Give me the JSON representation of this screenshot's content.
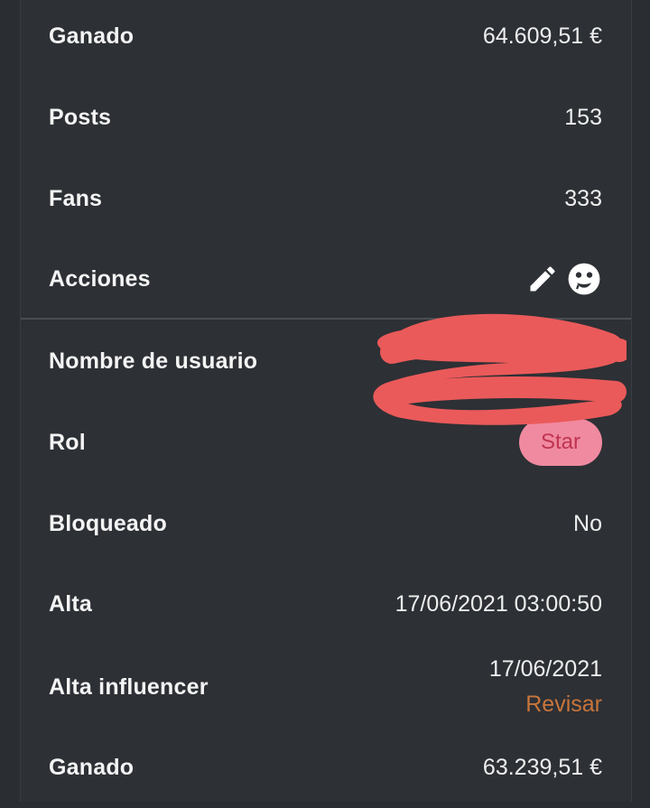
{
  "rows": {
    "ganado_top": {
      "label": "Ganado",
      "value": "64.609,51 €"
    },
    "posts": {
      "label": "Posts",
      "value": "153"
    },
    "fans": {
      "label": "Fans",
      "value": "333"
    },
    "acciones": {
      "label": "Acciones",
      "icons": [
        "pencil-icon",
        "face-icon"
      ]
    },
    "username": {
      "label": "Nombre de usuario",
      "value": ""
    },
    "rol": {
      "label": "Rol",
      "value": "Star",
      "badge_bg": "#f08aa0",
      "badge_fg": "#c03450"
    },
    "bloqueado": {
      "label": "Bloqueado",
      "value": "No"
    },
    "alta": {
      "label": "Alta",
      "value": "17/06/2021 03:00:50"
    },
    "alta_influencer": {
      "label": "Alta influencer",
      "value": "17/06/2021",
      "link": "Revisar",
      "link_color": "#c8753b"
    },
    "ganado_bottom": {
      "label": "Ganado",
      "value": "63.239,51 €"
    }
  },
  "redaction_color": "#ea5a5a"
}
